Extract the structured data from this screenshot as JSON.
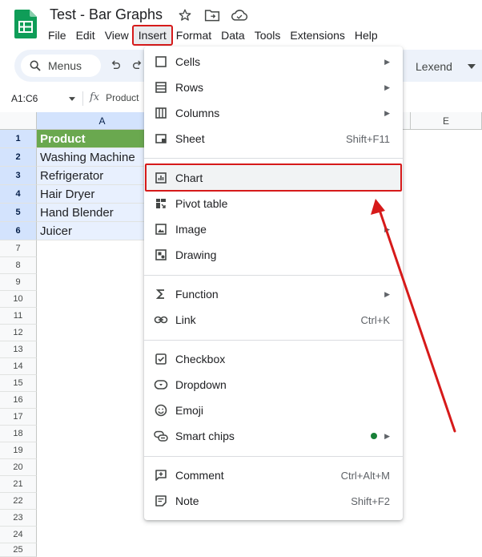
{
  "window": {
    "title": "Test - Bar Graphs",
    "icons": [
      "star-icon",
      "move-to-folder-icon",
      "cloud-saved-icon"
    ]
  },
  "menubar": [
    "File",
    "Edit",
    "View",
    "Insert",
    "Format",
    "Data",
    "Tools",
    "Extensions",
    "Help"
  ],
  "toolbar": {
    "search_label": "Menus",
    "font_name": "Lexend"
  },
  "formula_bar": {
    "range": "A1:C6",
    "value": "Product"
  },
  "grid": {
    "columns": [
      "A",
      "E"
    ],
    "rows": [
      "1",
      "2",
      "3",
      "4",
      "5",
      "6",
      "7",
      "8",
      "9",
      "10",
      "11",
      "12",
      "13",
      "14",
      "15",
      "16",
      "17",
      "18",
      "19",
      "20",
      "21",
      "22",
      "23",
      "24",
      "25"
    ],
    "cells": [
      "Product",
      "Washing Machine",
      "Refrigerator",
      "Hair Dryer",
      "Hand Blender",
      "Juicer"
    ],
    "colors": {
      "header_fill": "#6aa84f",
      "selection_fill": "#e8f0fe"
    }
  },
  "insert_menu": {
    "items": [
      {
        "label": "Cells",
        "shortcut": "",
        "submenu": true,
        "icon": "square-icon"
      },
      {
        "label": "Rows",
        "shortcut": "",
        "submenu": true,
        "icon": "rows-icon"
      },
      {
        "label": "Columns",
        "shortcut": "",
        "submenu": true,
        "icon": "columns-icon"
      },
      {
        "label": "Sheet",
        "shortcut": "Shift+F11",
        "submenu": false,
        "icon": "sheet-icon"
      },
      {
        "label": "Chart",
        "shortcut": "",
        "submenu": false,
        "icon": "chart-icon"
      },
      {
        "label": "Pivot table",
        "shortcut": "",
        "submenu": false,
        "icon": "pivot-table-icon"
      },
      {
        "label": "Image",
        "shortcut": "",
        "submenu": true,
        "icon": "image-icon"
      },
      {
        "label": "Drawing",
        "shortcut": "",
        "submenu": false,
        "icon": "drawing-icon"
      },
      {
        "label": "Function",
        "shortcut": "",
        "submenu": true,
        "icon": "sigma-icon"
      },
      {
        "label": "Link",
        "shortcut": "Ctrl+K",
        "submenu": false,
        "icon": "link-icon"
      },
      {
        "label": "Checkbox",
        "shortcut": "",
        "submenu": false,
        "icon": "checkbox-icon"
      },
      {
        "label": "Dropdown",
        "shortcut": "",
        "submenu": false,
        "icon": "dropdown-icon"
      },
      {
        "label": "Emoji",
        "shortcut": "",
        "submenu": false,
        "icon": "emoji-icon"
      },
      {
        "label": "Smart chips",
        "shortcut": "",
        "submenu": true,
        "icon": "smart-chips-icon"
      },
      {
        "label": "Comment",
        "shortcut": "Ctrl+Alt+M",
        "submenu": false,
        "icon": "comment-icon"
      },
      {
        "label": "Note",
        "shortcut": "Shift+F2",
        "submenu": false,
        "icon": "note-icon"
      }
    ],
    "annotation_color": "#d61a1a"
  }
}
